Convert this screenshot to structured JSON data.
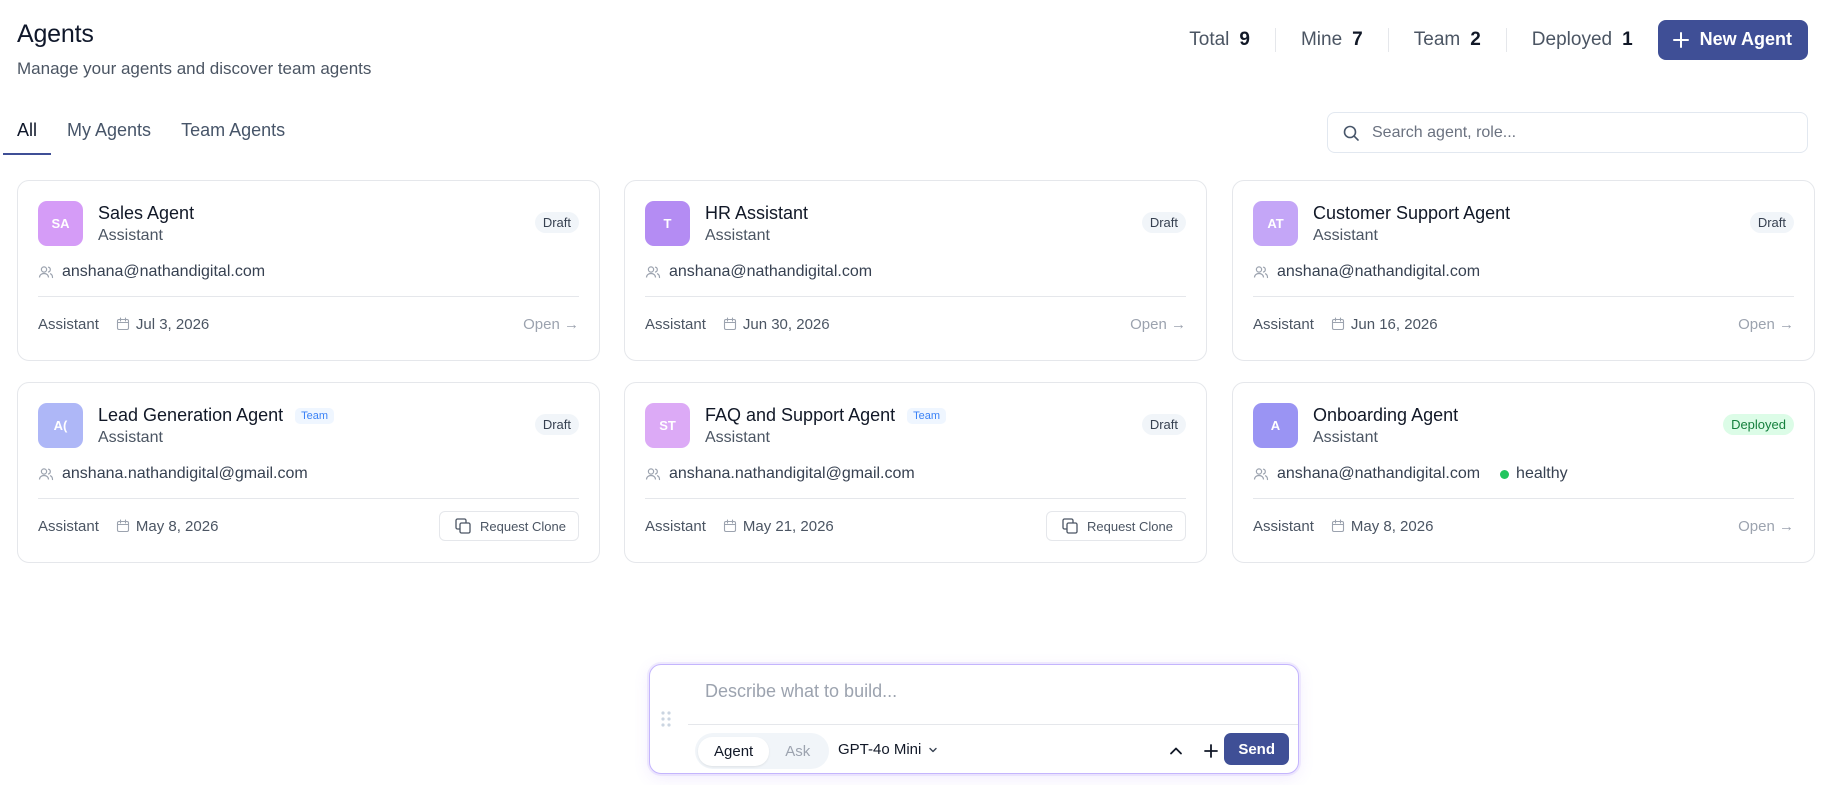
{
  "header": {
    "title": "Agents",
    "subtitle": "Manage your agents and discover team agents"
  },
  "stats": [
    {
      "label": "Total",
      "value": "9"
    },
    {
      "label": "Mine",
      "value": "7"
    },
    {
      "label": "Team",
      "value": "2"
    },
    {
      "label": "Deployed",
      "value": "1"
    }
  ],
  "new_agent_label": "New Agent",
  "tabs": [
    {
      "label": "All",
      "active": true
    },
    {
      "label": "My Agents",
      "active": false
    },
    {
      "label": "Team Agents",
      "active": false
    }
  ],
  "search": {
    "placeholder": "Search agent, role...",
    "value": ""
  },
  "cards": [
    {
      "initials": "SA",
      "avatar_color": "#d59cf7",
      "name": "Sales Agent",
      "team": "",
      "role": "Assistant",
      "status": "Draft",
      "owner": "anshana@nathandigital.com",
      "health": "",
      "type": "Assistant",
      "date": "Jul 3, 2026",
      "action": "Open →"
    },
    {
      "initials": "T",
      "avatar_color": "#b48cf3",
      "name": "HR Assistant",
      "team": "",
      "role": "Assistant",
      "status": "Draft",
      "owner": "anshana@nathandigital.com",
      "health": "",
      "type": "Assistant",
      "date": "Jun 30, 2026",
      "action": "Open →"
    },
    {
      "initials": "AT",
      "avatar_color": "#c4a6f7",
      "name": "Customer Support Agent",
      "team": "",
      "role": "Assistant",
      "status": "Draft",
      "owner": "anshana@nathandigital.com",
      "health": "",
      "type": "Assistant",
      "date": "Jun 16, 2026",
      "action": "Open →"
    },
    {
      "initials": "A(",
      "avatar_color": "#aeb7f7",
      "name": "Lead Generation Agent",
      "team": "Team",
      "role": "Assistant",
      "status": "Draft",
      "owner": "anshana.nathandigital@gmail.com",
      "health": "",
      "type": "Assistant",
      "date": "May 8, 2026",
      "action": "Request Clone"
    },
    {
      "initials": "ST",
      "avatar_color": "#dcaaf6",
      "name": "FAQ and Support Agent",
      "team": "Team",
      "role": "Assistant",
      "status": "Draft",
      "owner": "anshana.nathandigital@gmail.com",
      "health": "",
      "type": "Assistant",
      "date": "May 21, 2026",
      "action": "Request Clone"
    },
    {
      "initials": "A",
      "avatar_color": "#9a94f3",
      "name": "Onboarding Agent",
      "team": "",
      "role": "Assistant",
      "status": "Deployed",
      "owner": "anshana@nathandigital.com",
      "health": "healthy",
      "type": "Assistant",
      "date": "May 8, 2026",
      "action": "Open →"
    }
  ],
  "composer": {
    "placeholder": "Describe what to build...",
    "modes": [
      "Agent",
      "Ask"
    ],
    "active_mode": "Agent",
    "model": "GPT-4o Mini",
    "send_label": "Send"
  },
  "colors": {
    "primary": "#3f4f96",
    "healthy": "#22c55e",
    "deployed_bg": "#dcfce7",
    "team_badge": "#3b82f6"
  }
}
